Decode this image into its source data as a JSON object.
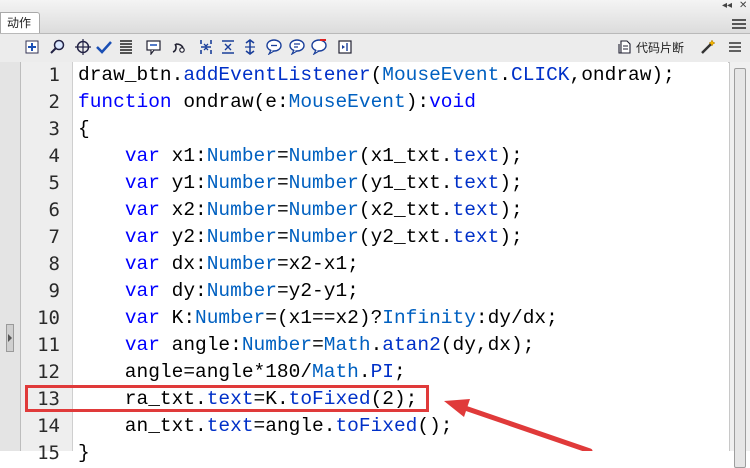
{
  "panel": {
    "tab_label": "动作",
    "window_controls": "◂◂ ✕"
  },
  "toolbar": {
    "snippet_label": "代码片断",
    "icons": [
      "add-icon",
      "find-icon",
      "target-icon",
      "check-syntax-icon",
      "auto-format-icon",
      "code-hint-icon",
      "debug-icon",
      "collapse-between-icon",
      "collapse-selection-icon",
      "expand-all-icon",
      "comment-icon",
      "uncomment-line-icon",
      "remove-comment-icon",
      "script-assist-icon",
      "snippets-icon",
      "help-wand-icon"
    ]
  },
  "code": {
    "lines": [
      {
        "n": "1",
        "tokens": [
          {
            "t": "draw_btn.",
            "c": "plain"
          },
          {
            "t": "addEventListener",
            "c": "prop"
          },
          {
            "t": "(",
            "c": "plain"
          },
          {
            "t": "MouseEvent",
            "c": "cls"
          },
          {
            "t": ".",
            "c": "plain"
          },
          {
            "t": "CLICK",
            "c": "prop"
          },
          {
            "t": ",ondraw);",
            "c": "plain"
          }
        ]
      },
      {
        "n": "2",
        "tokens": [
          {
            "t": "function",
            "c": "kw"
          },
          {
            "t": " ondraw(e:",
            "c": "plain"
          },
          {
            "t": "MouseEvent",
            "c": "cls"
          },
          {
            "t": "):",
            "c": "plain"
          },
          {
            "t": "void",
            "c": "kw"
          }
        ]
      },
      {
        "n": "3",
        "tokens": [
          {
            "t": "{",
            "c": "plain"
          }
        ]
      },
      {
        "n": "4",
        "tokens": [
          {
            "t": "    ",
            "c": "plain"
          },
          {
            "t": "var",
            "c": "kw"
          },
          {
            "t": " x1:",
            "c": "plain"
          },
          {
            "t": "Number",
            "c": "cls"
          },
          {
            "t": "=",
            "c": "plain"
          },
          {
            "t": "Number",
            "c": "cls"
          },
          {
            "t": "(x1_txt.",
            "c": "plain"
          },
          {
            "t": "text",
            "c": "prop"
          },
          {
            "t": ");",
            "c": "plain"
          }
        ]
      },
      {
        "n": "5",
        "tokens": [
          {
            "t": "    ",
            "c": "plain"
          },
          {
            "t": "var",
            "c": "kw"
          },
          {
            "t": " y1:",
            "c": "plain"
          },
          {
            "t": "Number",
            "c": "cls"
          },
          {
            "t": "=",
            "c": "plain"
          },
          {
            "t": "Number",
            "c": "cls"
          },
          {
            "t": "(y1_txt.",
            "c": "plain"
          },
          {
            "t": "text",
            "c": "prop"
          },
          {
            "t": ");",
            "c": "plain"
          }
        ]
      },
      {
        "n": "6",
        "tokens": [
          {
            "t": "    ",
            "c": "plain"
          },
          {
            "t": "var",
            "c": "kw"
          },
          {
            "t": " x2:",
            "c": "plain"
          },
          {
            "t": "Number",
            "c": "cls"
          },
          {
            "t": "=",
            "c": "plain"
          },
          {
            "t": "Number",
            "c": "cls"
          },
          {
            "t": "(x2_txt.",
            "c": "plain"
          },
          {
            "t": "text",
            "c": "prop"
          },
          {
            "t": ");",
            "c": "plain"
          }
        ]
      },
      {
        "n": "7",
        "tokens": [
          {
            "t": "    ",
            "c": "plain"
          },
          {
            "t": "var",
            "c": "kw"
          },
          {
            "t": " y2:",
            "c": "plain"
          },
          {
            "t": "Number",
            "c": "cls"
          },
          {
            "t": "=",
            "c": "plain"
          },
          {
            "t": "Number",
            "c": "cls"
          },
          {
            "t": "(y2_txt.",
            "c": "plain"
          },
          {
            "t": "text",
            "c": "prop"
          },
          {
            "t": ");",
            "c": "plain"
          }
        ]
      },
      {
        "n": "8",
        "tokens": [
          {
            "t": "    ",
            "c": "plain"
          },
          {
            "t": "var",
            "c": "kw"
          },
          {
            "t": " dx:",
            "c": "plain"
          },
          {
            "t": "Number",
            "c": "cls"
          },
          {
            "t": "=x2-x1;",
            "c": "plain"
          }
        ]
      },
      {
        "n": "9",
        "tokens": [
          {
            "t": "    ",
            "c": "plain"
          },
          {
            "t": "var",
            "c": "kw"
          },
          {
            "t": " dy:",
            "c": "plain"
          },
          {
            "t": "Number",
            "c": "cls"
          },
          {
            "t": "=y2-y1;",
            "c": "plain"
          }
        ]
      },
      {
        "n": "10",
        "tokens": [
          {
            "t": "    ",
            "c": "plain"
          },
          {
            "t": "var",
            "c": "kw"
          },
          {
            "t": " K:",
            "c": "plain"
          },
          {
            "t": "Number",
            "c": "cls"
          },
          {
            "t": "=(x1==x2)?",
            "c": "plain"
          },
          {
            "t": "Infinity",
            "c": "cls"
          },
          {
            "t": ":dy/dx;",
            "c": "plain"
          }
        ]
      },
      {
        "n": "11",
        "tokens": [
          {
            "t": "    ",
            "c": "plain"
          },
          {
            "t": "var",
            "c": "kw"
          },
          {
            "t": " angle:",
            "c": "plain"
          },
          {
            "t": "Number",
            "c": "cls"
          },
          {
            "t": "=",
            "c": "plain"
          },
          {
            "t": "Math",
            "c": "cls"
          },
          {
            "t": ".",
            "c": "plain"
          },
          {
            "t": "atan2",
            "c": "prop"
          },
          {
            "t": "(dy,dx);",
            "c": "plain"
          }
        ]
      },
      {
        "n": "12",
        "tokens": [
          {
            "t": "    angle=angle*180/",
            "c": "plain"
          },
          {
            "t": "Math",
            "c": "cls"
          },
          {
            "t": ".",
            "c": "plain"
          },
          {
            "t": "PI",
            "c": "prop"
          },
          {
            "t": ";",
            "c": "plain"
          }
        ]
      },
      {
        "n": "13",
        "tokens": [
          {
            "t": "    ra_txt.",
            "c": "plain"
          },
          {
            "t": "text",
            "c": "prop"
          },
          {
            "t": "=K.",
            "c": "plain"
          },
          {
            "t": "toFixed",
            "c": "prop"
          },
          {
            "t": "(2);",
            "c": "plain"
          }
        ]
      },
      {
        "n": "14",
        "tokens": [
          {
            "t": "    an_txt.",
            "c": "plain"
          },
          {
            "t": "text",
            "c": "prop"
          },
          {
            "t": "=angle.",
            "c": "plain"
          },
          {
            "t": "toFixed",
            "c": "prop"
          },
          {
            "t": "();",
            "c": "plain"
          }
        ]
      },
      {
        "n": "15",
        "tokens": [
          {
            "t": "}",
            "c": "plain"
          }
        ]
      }
    ],
    "highlighted_line": "13"
  },
  "colors": {
    "keyword": "#0000ff",
    "class": "#0060c0",
    "property": "#0030c8",
    "annotation": "#e03a3a"
  }
}
